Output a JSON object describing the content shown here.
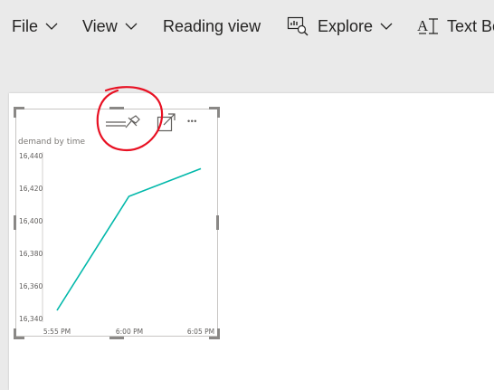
{
  "menu": {
    "file": "File",
    "view": "View",
    "reading_view": "Reading view",
    "explore": "Explore",
    "text_box": "Text Bo"
  },
  "icons": {
    "chevron": "chevron-down-icon",
    "explore": "explore-icon",
    "text_box": "text-box-icon",
    "pin": "pin-icon",
    "focus": "focus-mode-icon",
    "more": "more-options-icon"
  },
  "visual": {
    "more_label": "• • •"
  },
  "colors": {
    "series": "#01b8aa",
    "annotation": "#e81123"
  },
  "chart_data": {
    "type": "line",
    "title": "demand by time",
    "x": [
      "5:55 PM",
      "6:00 PM",
      "6:05 PM"
    ],
    "y_ticks": [
      "16,340",
      "16,360",
      "16,380",
      "16,400",
      "16,420",
      "16,440"
    ],
    "ylim": [
      16340,
      16440
    ],
    "series": [
      {
        "values": [
          16345,
          16415,
          16432
        ]
      }
    ],
    "grid": false
  }
}
